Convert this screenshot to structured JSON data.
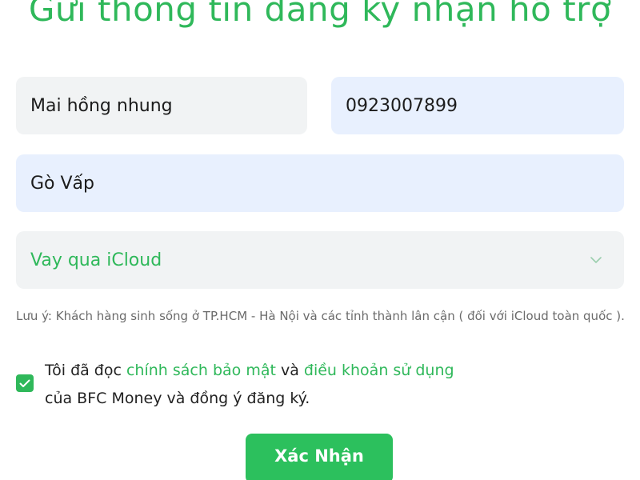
{
  "form": {
    "title": "Gửi thông tin đăng ký nhận hỗ trợ",
    "name_value": "Mai hồng nhung",
    "phone_value": "0923007899",
    "address_value": "Gò Vấp",
    "loan_type_selected": "Vay qua iCloud",
    "note": "Lưu ý: Khách hàng sinh sống ở TP.HCM - Hà Nội và các tỉnh thành lân cận ( đối với iCloud toàn quốc ).",
    "agreement": {
      "prefix": "Tôi đã đọc ",
      "privacy_link": "chính sách bảo mật",
      "middle": " và ",
      "terms_link": "điều khoản sử dụng",
      "suffix": "của BFC Money và đồng ý đăng ký.",
      "checked": true
    },
    "submit_label": "Xác Nhận"
  },
  "colors": {
    "accent": "#2fb85a",
    "button": "#2cc05d",
    "field_gray": "#f1f3f4",
    "field_blue": "#e8f0fe",
    "note_text": "#6b6b6b"
  },
  "icons": {
    "select_arrow": "chevron-down-icon",
    "checkbox_mark": "check-icon"
  }
}
